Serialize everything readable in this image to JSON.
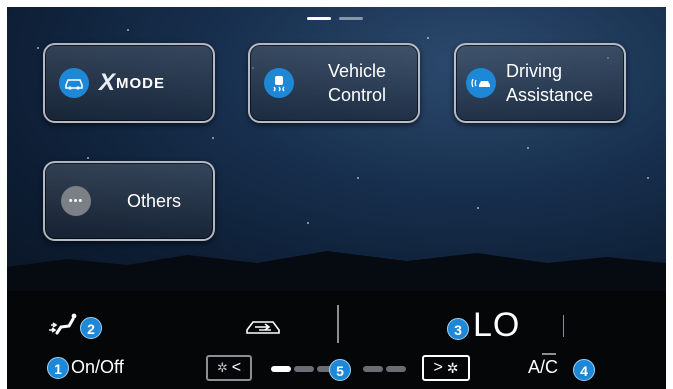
{
  "pager": {
    "count": 2,
    "active_index": 0
  },
  "tiles": {
    "xmode": {
      "brand": "X",
      "label": "MODE",
      "icon": "car-icon"
    },
    "vehicle_control": {
      "label_line1": "Vehicle",
      "label_line2": "Control",
      "icon": "skid-car-icon"
    },
    "driving_assistance": {
      "label_line1": "Driving",
      "label_line2": "Assistance",
      "icon": "radar-car-icon"
    },
    "others": {
      "label": "Others",
      "icon": "ellipsis-icon",
      "icon_glyph": "•••"
    }
  },
  "climate": {
    "onoff_label": "On/Off",
    "temperature": "LO",
    "ac_label": "A/C",
    "fan_level": 1,
    "fan_max": 7,
    "callouts": {
      "onoff": "1",
      "mode": "2",
      "temp": "3",
      "ac": "4",
      "fan": "5"
    }
  },
  "colors": {
    "accent": "#1e88d6",
    "panel": "#050608",
    "sky": "#172f4d"
  }
}
